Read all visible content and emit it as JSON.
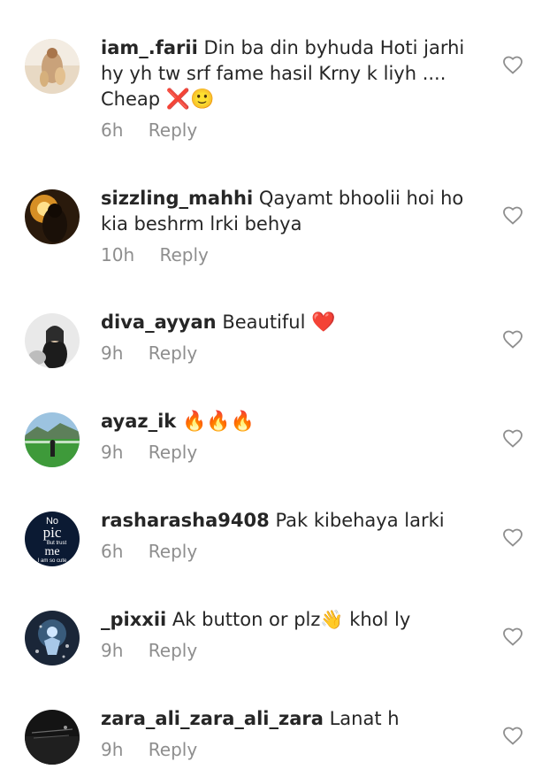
{
  "comments": [
    {
      "username": "iam_.farii",
      "text": "Din ba din byhuda Hoti jarhi hy yh tw srf fame hasil Krny k liyh .... Cheap",
      "emojis": "❌🙂",
      "time": "6h",
      "reply": "Reply"
    },
    {
      "username": "sizzling_mahhi",
      "text": "Qayamt bhoolii hoi ho kia beshrm lrki behya",
      "emojis": "",
      "time": "10h",
      "reply": "Reply"
    },
    {
      "username": "diva_ayyan",
      "text": "Beautiful",
      "emojis": "❤️",
      "time": "9h",
      "reply": "Reply"
    },
    {
      "username": "ayaz_ik",
      "text": "",
      "emojis": "🔥🔥🔥",
      "time": "9h",
      "reply": "Reply"
    },
    {
      "username": "rasharasha9408",
      "text": "Pak kibehaya larki",
      "emojis": "",
      "time": "6h",
      "reply": "Reply"
    },
    {
      "username": "_pixxii",
      "text": "Ak button or plz👋 khol ly",
      "emojis": "",
      "time": "9h",
      "reply": "Reply"
    },
    {
      "username": "zara_ali_zara_ali_zara",
      "text": "Lanat h",
      "emojis": "",
      "time": "9h",
      "reply": "Reply"
    }
  ],
  "avatar_4_text": {
    "line1": "No",
    "line2": "pic",
    "line3": "But trust",
    "line4": "me",
    "line5": "I am so cute"
  },
  "icons": {
    "like": "heart-outline-icon"
  },
  "colors": {
    "text": "#262626",
    "meta": "#8e8e8e",
    "heart_outline": "#8e8e8e"
  }
}
